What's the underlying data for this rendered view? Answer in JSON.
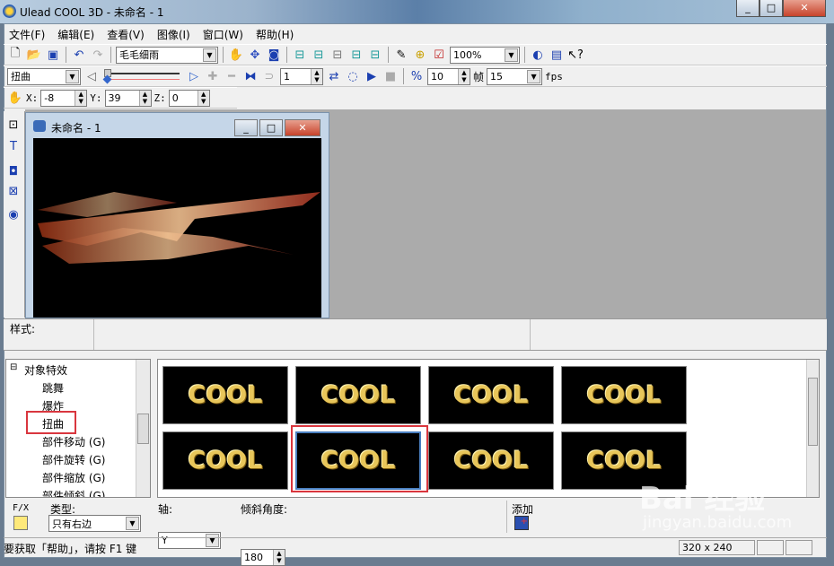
{
  "window": {
    "title": "Ulead COOL 3D - 未命名 - 1",
    "controls": [
      "_",
      "□",
      "✕"
    ]
  },
  "menu": [
    "文件(F)",
    "编辑(E)",
    "查看(V)",
    "图像(I)",
    "窗口(W)",
    "帮助(H)"
  ],
  "toolbar1": {
    "font_combo": "毛毛细雨",
    "zoom_combo": "100%"
  },
  "toolbar2": {
    "effect_combo": "扭曲",
    "frame_value": "1",
    "fps_frames": "10",
    "frame_label": "帧",
    "fps_value": "15",
    "fps_label": "fps"
  },
  "toolbar3": {
    "x_label": "X:",
    "x_value": "-8",
    "y_label": "Y:",
    "y_value": "39",
    "z_label": "Z:",
    "z_value": "0"
  },
  "child_window": {
    "title": "未命名 - 1"
  },
  "style_bar": {
    "label": "样式:"
  },
  "tree": {
    "root": "对象特效",
    "items": [
      "跳舞",
      "爆炸",
      "扭曲",
      "部件移动 (G)",
      "部件旋转 (G)",
      "部件缩放 (G)",
      "部件倾斜 (G)"
    ],
    "selected": "扭曲"
  },
  "thumbnails": {
    "items": [
      "COOL",
      "COOL",
      "COOL",
      "COOL",
      "COOL",
      "COOL",
      "COOL",
      "COOL"
    ],
    "selected_index": 5,
    "highlight_color": "#d9363e"
  },
  "attributes": {
    "fx_label": "F/X",
    "type_label": "类型:",
    "type_value": "只有右边",
    "axis_label": "轴:",
    "axis_value": "Y",
    "angle_label": "倾斜角度:",
    "angle_value": "180",
    "add_label": "添加"
  },
  "status": {
    "help_text": "要获取「帮助」，请按 F1 键",
    "size": "320 x 240"
  },
  "watermark": {
    "text": "Bai 经验",
    "sub": "jingyan.baidu.com"
  }
}
